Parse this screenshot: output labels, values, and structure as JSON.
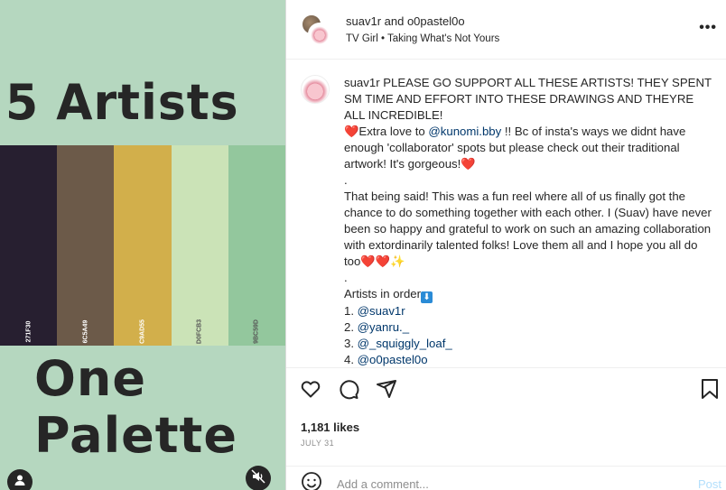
{
  "media": {
    "headline_top": "5 Artists",
    "headline_bottom": "One Palette",
    "swatches": [
      {
        "hex": "271F30",
        "color": "#271f30",
        "label_color": "#ffffff"
      },
      {
        "hex": "6C5A49",
        "color": "#6c5a49",
        "label_color": "#ffffff"
      },
      {
        "hex": "C9AD55",
        "color": "#d2af4b",
        "label_color": "#ffffff"
      },
      {
        "hex": "D0FCB3",
        "color": "#cbe3b7",
        "label_color": "#555555"
      },
      {
        "hex": "9BC59D",
        "color": "#93c79d",
        "label_color": "#555555"
      }
    ],
    "background": "#b5d7bf"
  },
  "header": {
    "title_user1": "suav1r",
    "title_and": " and ",
    "title_user2": "o0pastel0o",
    "music_artist": "TV Girl",
    "music_sep": " • ",
    "music_track": "Taking What's Not Yours",
    "more_label": "•••"
  },
  "caption": {
    "username": "suav1r",
    "line1": " PLEASE GO SUPPORT ALL THESE ARTISTS! THEY SPENT SM TIME AND EFFORT INTO THESE DRAWINGS AND THEYRE ALL INCREDIBLE!",
    "heart": "❤️",
    "extra_a": "Extra love to ",
    "mention1": "@kunomi.bby",
    "extra_b": " !! Bc of insta's ways we didnt have enough 'collaborator' spots but please check out their traditional artwork! It's gorgeous!",
    "dot": ".",
    "para2": "That being said! This was a fun reel where all of us finally got the chance to do something together with each other. I (Suav) have never been so happy and grateful to work on such an amazing collaboration with extordinarily talented folks! Love them all and I hope you all do too",
    "sparkle": "✨",
    "artists_header": "Artists in order",
    "down_arrow": "⬇",
    "artists": [
      {
        "num": "1. ",
        "handle": "@suav1r"
      },
      {
        "num": "2. ",
        "handle": "@yanru._"
      },
      {
        "num": "3. ",
        "handle": "@_squiggly_loaf_"
      },
      {
        "num": "4. ",
        "handle": "@o0pastel0o"
      }
    ]
  },
  "actions": {
    "likes": "1,181 likes",
    "date": "JULY 31",
    "comment_placeholder": "Add a comment...",
    "post_label": "Post"
  },
  "icons": [
    "user-icon",
    "muted-speaker-icon",
    "heart-icon",
    "comment-icon",
    "share-icon",
    "bookmark-icon",
    "emoji-icon",
    "more-icon"
  ]
}
